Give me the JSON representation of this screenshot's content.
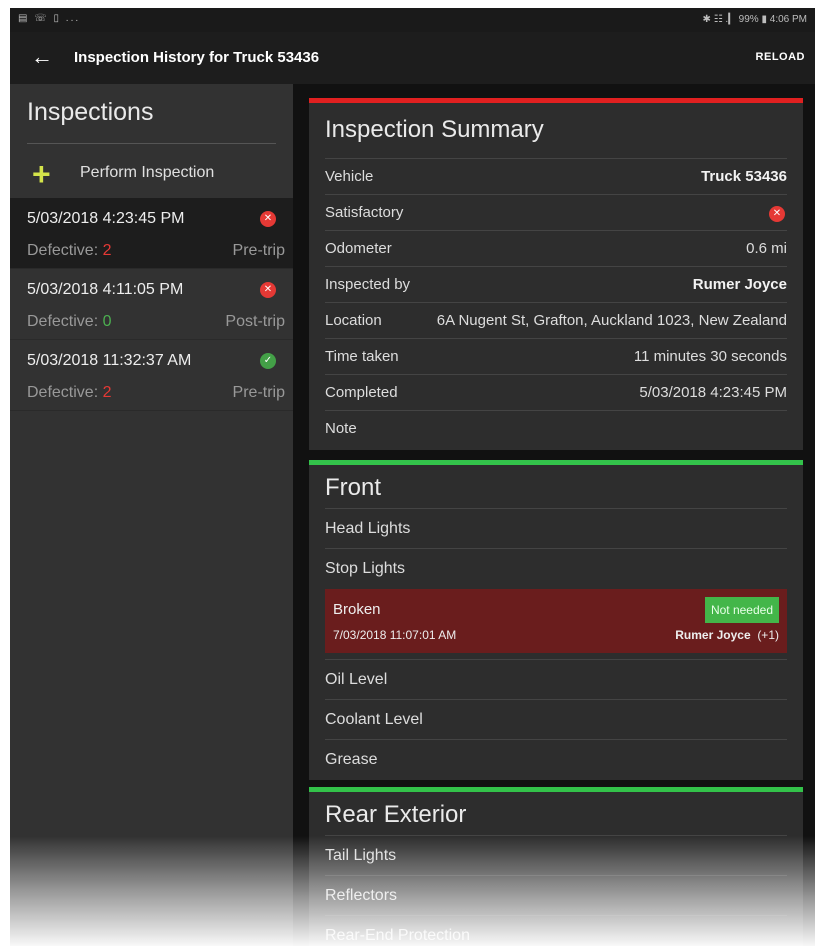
{
  "status_bar": {
    "left_icons": "▤ ☏ ▯ ...",
    "right_text": "✱ ☷ .▎ 99% ▮ 4:06 PM"
  },
  "app_bar": {
    "back_icon": "arrow-left-icon",
    "title": "Inspection History for Truck 53436",
    "reload_label": "RELOAD"
  },
  "sidebar": {
    "heading": "Inspections",
    "perform_label": "Perform Inspection",
    "inspections": [
      {
        "datetime": "5/03/2018 4:23:45 PM",
        "status": "defective",
        "defective_label": "Defective:",
        "defective_count": "2",
        "trip": "Pre-trip",
        "selected": true
      },
      {
        "datetime": "5/03/2018 4:11:05 PM",
        "status": "defective",
        "defective_label": "Defective:",
        "defective_count": "0",
        "trip": "Post-trip",
        "selected": false
      },
      {
        "datetime": "5/03/2018 11:32:37 AM",
        "status": "ok",
        "defective_label": "Defective:",
        "defective_count": "2",
        "trip": "Pre-trip",
        "selected": false
      }
    ]
  },
  "summary": {
    "title": "Inspection Summary",
    "rows": {
      "vehicle": {
        "label": "Vehicle",
        "value": "Truck 53436"
      },
      "satisfactory": {
        "label": "Satisfactory"
      },
      "odometer": {
        "label": "Odometer",
        "value": "0.6 mi"
      },
      "inspected_by": {
        "label": "Inspected by",
        "value": "Rumer Joyce"
      },
      "location": {
        "label": "Location",
        "value": "6A Nugent St, Grafton, Auckland 1023, New Zealand"
      },
      "time_taken": {
        "label": "Time taken",
        "value": "11 minutes 30 seconds"
      },
      "completed": {
        "label": "Completed",
        "value": "5/03/2018 4:23:45 PM"
      },
      "note": {
        "label": "Note"
      }
    }
  },
  "front": {
    "title": "Front",
    "items": [
      "Head Lights",
      "Stop Lights",
      "Oil Level",
      "Coolant Level",
      "Grease"
    ],
    "defect": {
      "title": "Broken",
      "datetime": "7/03/2018 11:07:01 AM",
      "badge": "Not needed",
      "inspector": "Rumer Joyce",
      "extra": "(+1)"
    }
  },
  "rear": {
    "title": "Rear Exterior",
    "items": [
      "Tail Lights",
      "Reflectors",
      "Rear-End Protection"
    ]
  },
  "colors": {
    "defective": "#e53935",
    "ok": "#43a047",
    "summary_bar": "#e02020",
    "section_bar": "#33c24a",
    "defect_bg": "#6a1d1d",
    "plus": "#d4e44a"
  }
}
